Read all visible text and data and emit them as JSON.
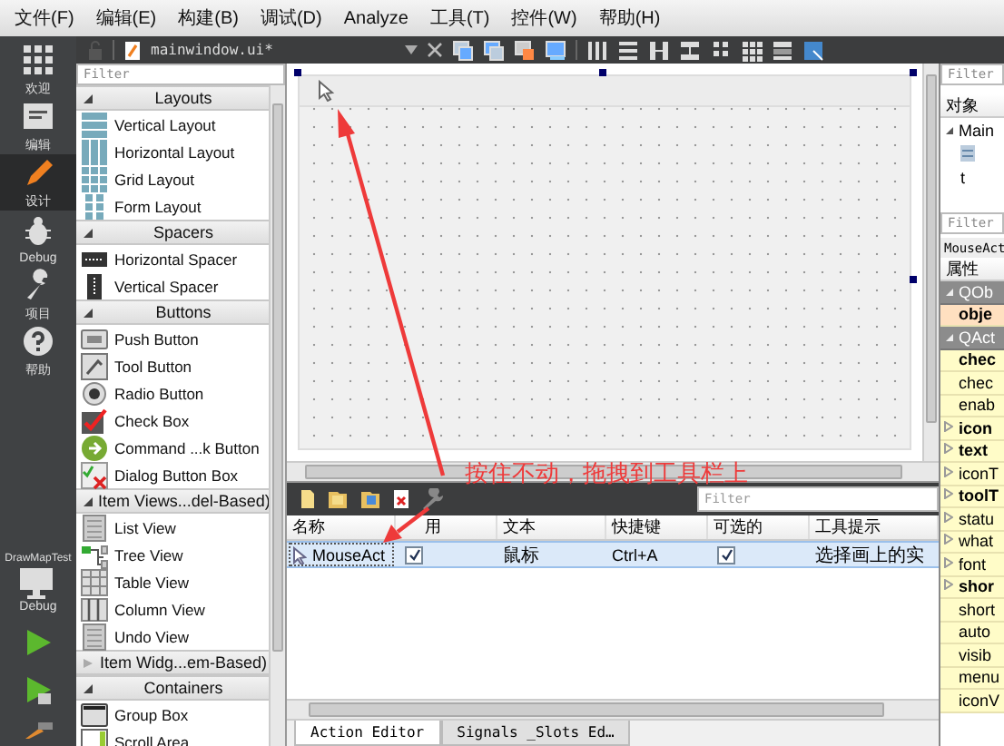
{
  "menu": [
    "文件(F)",
    "编辑(E)",
    "构建(B)",
    "调试(D)",
    "Analyze",
    "工具(T)",
    "控件(W)",
    "帮助(H)"
  ],
  "modes": [
    {
      "label": "欢迎",
      "selected": false
    },
    {
      "label": "编辑",
      "selected": false
    },
    {
      "label": "设计",
      "selected": true
    },
    {
      "label": "Debug",
      "selected": false
    },
    {
      "label": "项目",
      "selected": false
    },
    {
      "label": "帮助",
      "selected": false
    }
  ],
  "target": {
    "project": "DrawMapTest",
    "config": "Debug"
  },
  "editor_toolbar": {
    "file": "mainwindow.ui*"
  },
  "widget_box": {
    "filter_placeholder": "Filter",
    "sections": [
      {
        "title": "Layouts",
        "expanded": true,
        "items": [
          "Vertical Layout",
          "Horizontal Layout",
          "Grid Layout",
          "Form Layout"
        ]
      },
      {
        "title": "Spacers",
        "expanded": true,
        "items": [
          "Horizontal Spacer",
          "Vertical Spacer"
        ]
      },
      {
        "title": "Buttons",
        "expanded": true,
        "items": [
          "Push Button",
          "Tool Button",
          "Radio Button",
          "Check Box",
          "Command ...k Button",
          "Dialog Button Box"
        ]
      },
      {
        "title": "Item Views...del-Based)",
        "expanded": true,
        "items": [
          "List View",
          "Tree View",
          "Table View",
          "Column View",
          "Undo View"
        ]
      },
      {
        "title": "Item Widg...em-Based)",
        "expanded": false
      },
      {
        "title": "Containers",
        "expanded": true,
        "items": [
          "Group Box",
          "Scroll Area"
        ]
      }
    ]
  },
  "annotation": "按住不动，拖拽到工具栏上",
  "action_editor": {
    "filter_placeholder": "Filter",
    "columns": [
      "名称",
      "用",
      "文本",
      "快捷键",
      "可选的",
      "工具提示"
    ],
    "rows": [
      {
        "name": "MouseAct",
        "used": true,
        "text": "鼠标",
        "shortcut": "Ctrl+A",
        "checkable": true,
        "tooltip": "选择画上的实",
        "selected": true
      }
    ],
    "tabs": [
      {
        "label": "Action Editor",
        "selected": true
      },
      {
        "label": "Signals _Slots Ed…",
        "selected": false
      }
    ]
  },
  "object_inspector": {
    "filter_placeholder": "Filter",
    "header": "对象",
    "tree": [
      {
        "label": "Main",
        "children": [
          {
            "kind": "window"
          },
          {
            "label": "t"
          }
        ]
      }
    ]
  },
  "property_editor": {
    "filter_placeholder": "Filter",
    "object": "MouseAct",
    "header": "属性",
    "rows": [
      {
        "kind": "group",
        "label": "QOb"
      },
      {
        "kind": "property",
        "label": "obje",
        "bold": true,
        "expandable": false,
        "selected": true
      },
      {
        "kind": "group",
        "label": "QAct"
      },
      {
        "kind": "property",
        "label": "chec",
        "bold": true,
        "expandable": false,
        "selected": false
      },
      {
        "kind": "property",
        "label": "chec",
        "bold": false,
        "expandable": false,
        "selected": false
      },
      {
        "kind": "property",
        "label": "enab",
        "bold": false,
        "expandable": false,
        "selected": false
      },
      {
        "kind": "property",
        "label": "icon",
        "bold": true,
        "expandable": true,
        "selected": false
      },
      {
        "kind": "property",
        "label": "text",
        "bold": true,
        "expandable": true,
        "selected": false
      },
      {
        "kind": "property",
        "label": "iconT",
        "bold": false,
        "expandable": true,
        "selected": false
      },
      {
        "kind": "property",
        "label": "toolT",
        "bold": true,
        "expandable": true,
        "selected": false
      },
      {
        "kind": "property",
        "label": "statu",
        "bold": false,
        "expandable": true,
        "selected": false
      },
      {
        "kind": "property",
        "label": "what",
        "bold": false,
        "expandable": true,
        "selected": false
      },
      {
        "kind": "property",
        "label": "font",
        "bold": false,
        "expandable": true,
        "selected": false
      },
      {
        "kind": "property",
        "label": "shor",
        "bold": true,
        "expandable": true,
        "selected": false
      },
      {
        "kind": "property",
        "label": "short",
        "bold": false,
        "expandable": false,
        "selected": false
      },
      {
        "kind": "property",
        "label": "auto",
        "bold": false,
        "expandable": false,
        "selected": false
      },
      {
        "kind": "property",
        "label": "visib",
        "bold": false,
        "expandable": false,
        "selected": false
      },
      {
        "kind": "property",
        "label": "menu",
        "bold": false,
        "expandable": false,
        "selected": false
      },
      {
        "kind": "property",
        "label": "iconV",
        "bold": false,
        "expandable": false,
        "selected": false
      }
    ]
  }
}
